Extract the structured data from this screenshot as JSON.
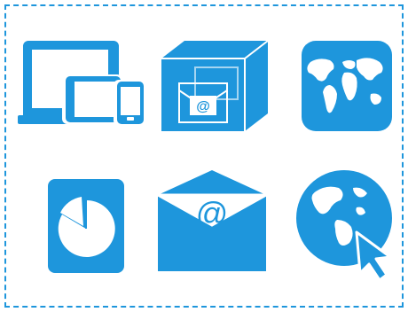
{
  "colors": {
    "primary": "#1e96dc",
    "background": "#ffffff",
    "frame_border": "#1e96dc"
  },
  "icons": [
    {
      "name": "responsive-devices-icon"
    },
    {
      "name": "email-box-icon",
      "glyph": "@"
    },
    {
      "name": "world-map-icon"
    },
    {
      "name": "pie-chart-document-icon"
    },
    {
      "name": "email-envelope-icon",
      "glyph": "@"
    },
    {
      "name": "globe-cursor-icon"
    }
  ]
}
